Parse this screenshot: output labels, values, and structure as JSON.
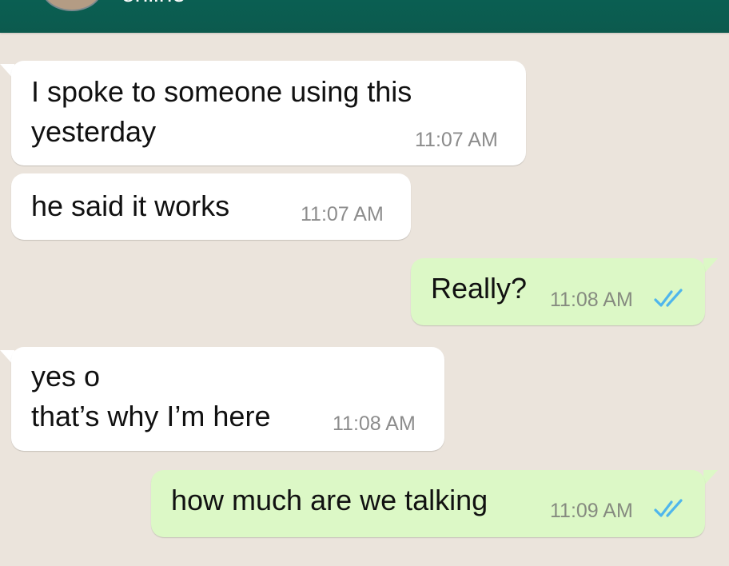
{
  "header": {
    "contact_status": "online"
  },
  "messages": [
    {
      "direction": "incoming",
      "text_line1": "I spoke to someone using this",
      "text_line2": "yesterday",
      "time": "11:07 AM"
    },
    {
      "direction": "incoming",
      "text": "he said it works",
      "time": "11:07 AM"
    },
    {
      "direction": "outgoing",
      "text": "Really?",
      "time": "11:08 AM",
      "status_icon": "double-check-read-icon"
    },
    {
      "direction": "incoming",
      "text_line1": "yes o",
      "text_line2": "that’s why I’m here",
      "time": "11:08 AM"
    },
    {
      "direction": "outgoing",
      "text": "how much are we talking",
      "time": "11:09 AM",
      "status_icon": "double-check-read-icon"
    }
  ],
  "colors": {
    "header": "#0a5f52",
    "chat_background": "#ebe4dc",
    "incoming_bubble": "#ffffff",
    "outgoing_bubble": "#dcf8c6",
    "read_ticks": "#4fb6ec"
  }
}
